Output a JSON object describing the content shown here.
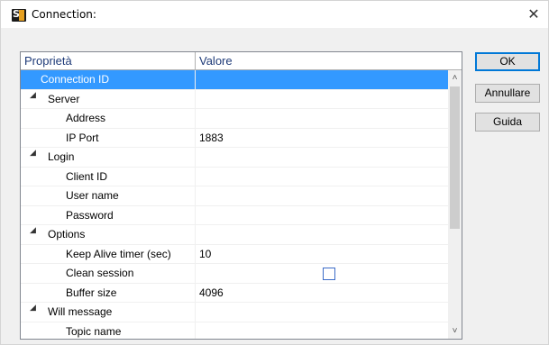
{
  "window": {
    "title": "Connection:",
    "app_icon": "s1-app-icon",
    "close_glyph": "✕"
  },
  "grid": {
    "headers": {
      "name": "Proprietà",
      "value": "Valore"
    },
    "rows": [
      {
        "kind": "prop",
        "name": "Connection ID",
        "value": "",
        "selected": true
      },
      {
        "kind": "cat",
        "name": "Server",
        "value": ""
      },
      {
        "kind": "prop",
        "name": "Address",
        "value": ""
      },
      {
        "kind": "prop",
        "name": "IP Port",
        "value": "1883"
      },
      {
        "kind": "cat",
        "name": "Login",
        "value": ""
      },
      {
        "kind": "prop",
        "name": "Client ID",
        "value": ""
      },
      {
        "kind": "prop",
        "name": "User name",
        "value": ""
      },
      {
        "kind": "prop",
        "name": "Password",
        "value": ""
      },
      {
        "kind": "cat",
        "name": "Options",
        "value": ""
      },
      {
        "kind": "prop",
        "name": "Keep Alive timer (sec)",
        "value": "10"
      },
      {
        "kind": "prop",
        "name": "Clean session",
        "value": "",
        "checkbox": true,
        "checked": false
      },
      {
        "kind": "prop",
        "name": "Buffer size",
        "value": "4096"
      },
      {
        "kind": "cat",
        "name": "Will message",
        "value": ""
      },
      {
        "kind": "prop",
        "name": "Topic name",
        "value": ""
      }
    ],
    "expander_glyph": "◢",
    "scroll_up_glyph": "˄",
    "scroll_down_glyph": "˅"
  },
  "buttons": {
    "ok": "OK",
    "cancel": "Annullare",
    "help": "Guida"
  },
  "colors": {
    "selection": "#3399ff",
    "header_text": "#1e3a78",
    "default_button_border": "#0078d7"
  }
}
